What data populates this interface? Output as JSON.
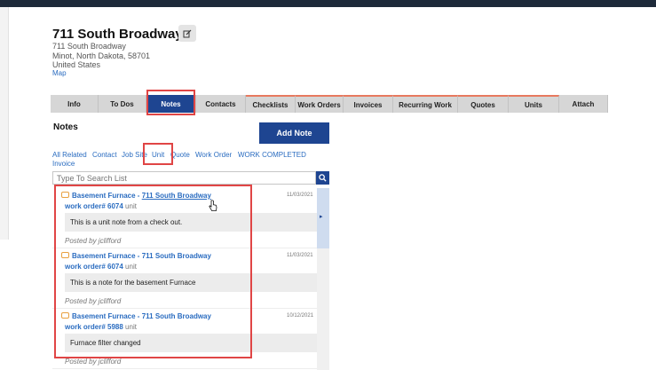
{
  "header": {
    "title": "711 South Broadway",
    "address_line1": "711 South Broadway",
    "address_line2": "Minot, North Dakota, 58701",
    "address_line3": "United States",
    "map_link": "Map"
  },
  "tabs": [
    {
      "label": "Info"
    },
    {
      "label": "To Dos"
    },
    {
      "label": "Notes"
    },
    {
      "label": "Contacts"
    },
    {
      "label": "Checklists"
    },
    {
      "label": "Work Orders"
    },
    {
      "label": "Invoices"
    },
    {
      "label": "Recurring Work"
    },
    {
      "label": "Quotes"
    },
    {
      "label": "Units"
    },
    {
      "label": "Attach"
    }
  ],
  "notes_panel": {
    "heading": "Notes",
    "add_button": "Add Note",
    "filters": [
      "All Related",
      "Contact",
      "Job Site",
      "Unit",
      "Quote",
      "Work Order",
      "WORK COMPLETED",
      "Invoice"
    ],
    "search_placeholder": "Type To Search List"
  },
  "notes": [
    {
      "title": "Basement Furnace - ",
      "location": "711 South Broadway",
      "date": "11/03/2021",
      "work_order": "work order# 6074",
      "unit": "unit",
      "text": "This is a unit note from a check out.",
      "posted_by": "Posted by jclifford"
    },
    {
      "title": "Basement Furnace - ",
      "location": "711 South Broadway",
      "date": "11/03/2021",
      "work_order": "work order# 6074",
      "unit": "unit",
      "text": "This is a note for the basement Furnace",
      "posted_by": "Posted by jclifford"
    },
    {
      "title": "Basement Furnace - ",
      "location": "711 South Broadway",
      "date": "10/12/2021",
      "work_order": "work order# 5988",
      "unit": "unit",
      "text": "Furnace filter changed",
      "posted_by": "Posted by jclifford"
    }
  ],
  "colors": {
    "primary": "#1e4591",
    "link": "#2a6cc0",
    "highlight": "#e04545",
    "tab_accent": "#e8795f"
  },
  "icons": [
    "edit-icon",
    "search-icon",
    "note-bubble-icon",
    "pointer-cursor-icon"
  ]
}
